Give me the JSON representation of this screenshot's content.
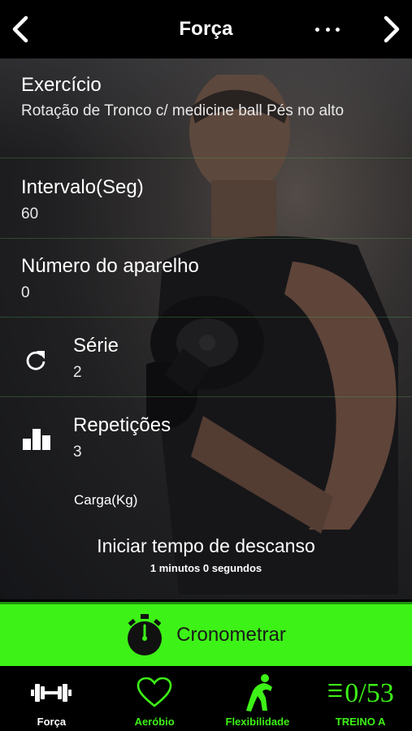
{
  "header": {
    "title": "Força"
  },
  "exercise": {
    "label": "Exercício",
    "value": "Rotação de Tronco c/ medicine ball Pés no alto"
  },
  "interval": {
    "label": "Intervalo(Seg)",
    "value": "60"
  },
  "machine": {
    "label": "Número do aparelho",
    "value": "0"
  },
  "series": {
    "label": "Série",
    "value": "2",
    "icon": "refresh-icon"
  },
  "reps": {
    "label": "Repetições",
    "value": "3",
    "icon": "bar-steps-icon"
  },
  "load": {
    "label": "Carga(Kg)"
  },
  "rest": {
    "title": "Iniciar tempo de descanso",
    "subtitle": "1 minutos 0 segundos"
  },
  "timer": {
    "label": "Cronometrar",
    "icon": "stopwatch-icon"
  },
  "nav": {
    "tabs": [
      {
        "label": "Força",
        "icon": "dumbbell-icon"
      },
      {
        "label": "Aeróbio",
        "icon": "heart-icon"
      },
      {
        "label": "Flexibilidade",
        "icon": "stretch-figure-icon"
      },
      {
        "label": "TREINO A",
        "icon": "list-icon",
        "counter": "0/53"
      }
    ]
  },
  "colors": {
    "accent": "#3df216",
    "background": "#000000"
  }
}
